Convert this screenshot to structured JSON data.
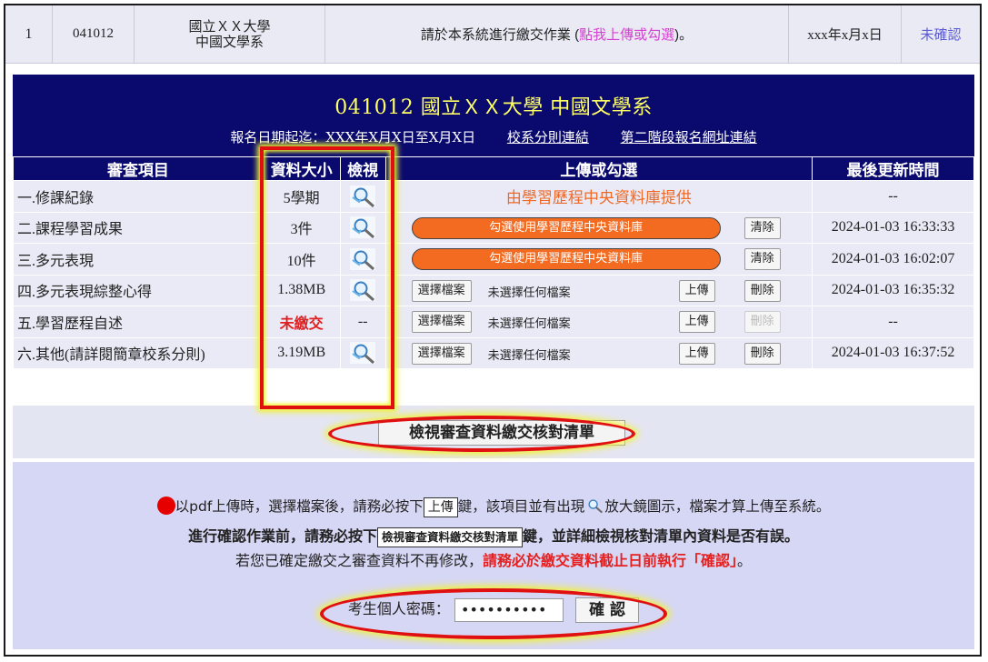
{
  "top_row": {
    "number": "1",
    "code": "041012",
    "school_line1": "國立ＸＸ大學",
    "school_line2": "中國文學系",
    "notice_pre": "請於本系統進行繳交作業 (",
    "notice_link": "點我上傳或勾選",
    "notice_post": ")。",
    "date": "xxx年x月x日",
    "status": "未確認"
  },
  "header": {
    "title": "041012 國立ＸＸ大學 中國文學系",
    "period": "報名日期起迄：XXX年X月X日至X月X日",
    "link1": "校系分則連結",
    "link2": "第二階段報名網址連結"
  },
  "table": {
    "headers": [
      "審查項目",
      "資料大小",
      "檢視",
      "上傳或勾選",
      "最後更新時間"
    ],
    "rows": [
      {
        "item": "一.修課紀錄",
        "size": "5學期",
        "view": "magnifier",
        "upload_text": "由學習歷程中央資料庫提供",
        "time": "--"
      },
      {
        "item": "二.課程學習成果",
        "size": "3件",
        "view": "magnifier",
        "upload_pill": "勾選使用學習歷程中央資料庫",
        "clear": "清除",
        "time": "2024-01-03 16:33:33"
      },
      {
        "item": "三.多元表現",
        "size": "10件",
        "view": "magnifier",
        "upload_pill": "勾選使用學習歷程中央資料庫",
        "clear": "清除",
        "time": "2024-01-03 16:02:07"
      },
      {
        "item": "四.多元表現綜整心得",
        "size": "1.38MB",
        "view": "magnifier",
        "choose": "選擇檔案",
        "file": "未選擇任何檔案",
        "upload": "上傳",
        "delete": "刪除",
        "time": "2024-01-03 16:35:32"
      },
      {
        "item": "五.學習歷程自述",
        "size": "未繳交",
        "view": "--",
        "choose": "選擇檔案",
        "file": "未選擇任何檔案",
        "upload": "上傳",
        "delete": "刪除",
        "time": "--"
      },
      {
        "item": "六.其他(請詳閱簡章校系分則)",
        "size": "3.19MB",
        "view": "magnifier",
        "choose": "選擇檔案",
        "file": "未選擇任何檔案",
        "upload": "上傳",
        "delete": "刪除",
        "time": "2024-01-03 16:37:52"
      }
    ]
  },
  "checklist_button": "檢視審查資料繳交核對清單",
  "notes": {
    "line1_a": "以pdf上傳時，選擇檔案後，請務必按下",
    "line1_btn": "上傳",
    "line1_b": "鍵，該項目並有出現",
    "line1_c": "放大鏡圖示，檔案才算上傳至系統。",
    "line2_a": "進行確認作業前，請務必按下",
    "line2_btn": "檢視審查資料繳交核對清單",
    "line2_b": "鍵，並詳細檢視核對清單內資料是否有誤。",
    "line3_a": "若您已確定繳交之審查資料不再修改，",
    "line3_red": "請務必於繳交資料截止日前執行「確認」",
    "line3_b": "。"
  },
  "password": {
    "label": "考生個人密碼：",
    "value": "••••••••••",
    "confirm": "確 認"
  },
  "colors": {
    "navy": "#0a0a6e",
    "orange": "#f26b21",
    "highlight_red": "#e01010",
    "highlight_yellow": "#f2f230"
  }
}
